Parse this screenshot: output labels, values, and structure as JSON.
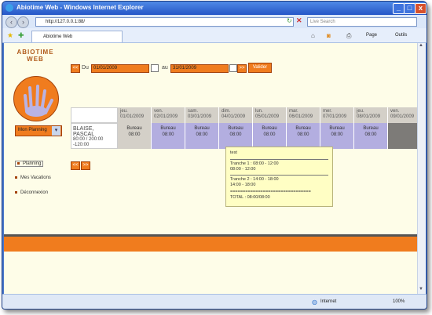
{
  "window": {
    "title": "Abiotime Web - Windows Internet Explorer",
    "minimize": "_",
    "maximize": "□",
    "close": "x"
  },
  "browser": {
    "url": "http://127.0.0.1:88/",
    "search_placeholder": "Live Search",
    "tab_title": "Abiotime Web",
    "page_label": "Page",
    "tools_label": "Outils"
  },
  "app": {
    "name_line1": "ABIOTIME",
    "name_line2": "WEB"
  },
  "filter": {
    "prev": "<<",
    "du_label": "Du",
    "date_from": "01/01/2009",
    "au_label": "au",
    "date_to": "31/01/2009",
    "next": ">>",
    "validate": "Valider"
  },
  "view_select": {
    "value": "Mon Planning"
  },
  "grid": {
    "days": [
      {
        "dow": "jeu.",
        "date": "01/01/2009"
      },
      {
        "dow": "ven.",
        "date": "02/01/2009"
      },
      {
        "dow": "sam.",
        "date": "03/01/2009"
      },
      {
        "dow": "dim.",
        "date": "04/01/2009"
      },
      {
        "dow": "lun.",
        "date": "05/01/2009"
      },
      {
        "dow": "mar.",
        "date": "06/01/2009"
      },
      {
        "dow": "mer.",
        "date": "07/01/2009"
      },
      {
        "dow": "jeu.",
        "date": "08/01/2009"
      },
      {
        "dow": "ven.",
        "date": "09/01/2009"
      }
    ],
    "employee": {
      "name": "BLAISE, PASCAL",
      "hours": "80:00 / 200:00",
      "balance": "-120:00"
    },
    "cells": [
      {
        "line1": "Bureau",
        "line2": "08:00",
        "type": "grey"
      },
      {
        "line1": "Bureau",
        "line2": "08:00",
        "type": "blue"
      },
      {
        "line1": "Bureau",
        "line2": "08:00",
        "type": "blue"
      },
      {
        "line1": "Bureau",
        "line2": "08:00",
        "type": "blue"
      },
      {
        "line1": "Bureau",
        "line2": "08:00",
        "type": "blue"
      },
      {
        "line1": "Bureau",
        "line2": "08:00",
        "type": "blue"
      },
      {
        "line1": "Bureau",
        "line2": "08:00",
        "type": "blue"
      },
      {
        "line1": "Bureau",
        "line2": "08:00",
        "type": "blue"
      },
      {
        "line1": "",
        "line2": "",
        "type": "dark"
      }
    ],
    "pager_prev": "<<",
    "pager_next": ">>"
  },
  "nav": {
    "items": [
      "Planning",
      "Mes Vacations",
      "Déconnexion"
    ]
  },
  "tooltip": {
    "title": "test",
    "t1": "Tranche 1 : 08:00 - 12:00",
    "t1b": "08:00 - 12:00",
    "t2": "Tranche 2 : 14:00 - 18:00",
    "t2b": "14:00 - 18:00",
    "sep": "================================",
    "total": "TOTAL : 08:00/08:00"
  },
  "status": {
    "zone": "Internet",
    "zoom": "100%"
  },
  "colors": {
    "accent": "#f07c1e",
    "cell_blue": "#b3aee0",
    "cell_grey": "#d4d0c8",
    "content_bg": "#fefde8",
    "footer": "#f07c1e"
  }
}
